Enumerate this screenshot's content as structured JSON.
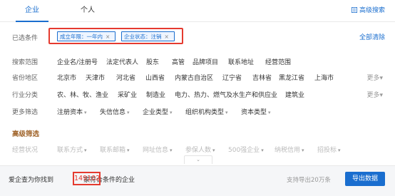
{
  "tabs": [
    {
      "label": "企业",
      "active": true
    },
    {
      "label": "个人",
      "active": false
    }
  ],
  "advanced_search_label": "高级搜索",
  "selected": {
    "label": "已选条件",
    "chips": [
      {
        "label": "成立年限：一年内",
        "close": "×"
      },
      {
        "label": "企业状态：注销",
        "close": "×"
      }
    ],
    "clear_all_label": "全部清除"
  },
  "filters": {
    "search_scope": {
      "label": "搜索范围",
      "options": [
        "企业名/注册号",
        "法定代表人",
        "股东",
        "高管",
        "品牌项目",
        "联系地址",
        "经营范围"
      ]
    },
    "province": {
      "label": "省份地区",
      "options": [
        "北京市",
        "天津市",
        "河北省",
        "山西省",
        "内蒙古自治区",
        "辽宁省",
        "吉林省",
        "黑龙江省",
        "上海市"
      ],
      "more_label": "更多"
    },
    "industry": {
      "label": "行业分类",
      "options": [
        "农、林、牧、渔业",
        "采矿业",
        "制造业",
        "电力、热力、燃气及水生产和供应业",
        "建筑业"
      ],
      "more_label": "更多"
    },
    "more_filters": {
      "label": "更多筛选",
      "options": [
        "注册资本",
        "失信信息",
        "企业类型",
        "组织机构类型",
        "资本类型"
      ]
    }
  },
  "advanced": {
    "title": "高级筛选",
    "row_label": "经营状况",
    "options": [
      "联系方式",
      "联系邮箱",
      "网址信息",
      "参保人数",
      "500强企业",
      "纳税信用",
      "招投标"
    ]
  },
  "caret": "▾",
  "collapse_icon": "⌄",
  "result": {
    "prefix": "爱企查为你找到",
    "count": "149102",
    "suffix": "家符合条件的企业",
    "export_note": "支持导出20万条",
    "export_label": "导出数据"
  },
  "colors": {
    "accent": "#1a6ecf",
    "highlight": "#e53a2f"
  }
}
